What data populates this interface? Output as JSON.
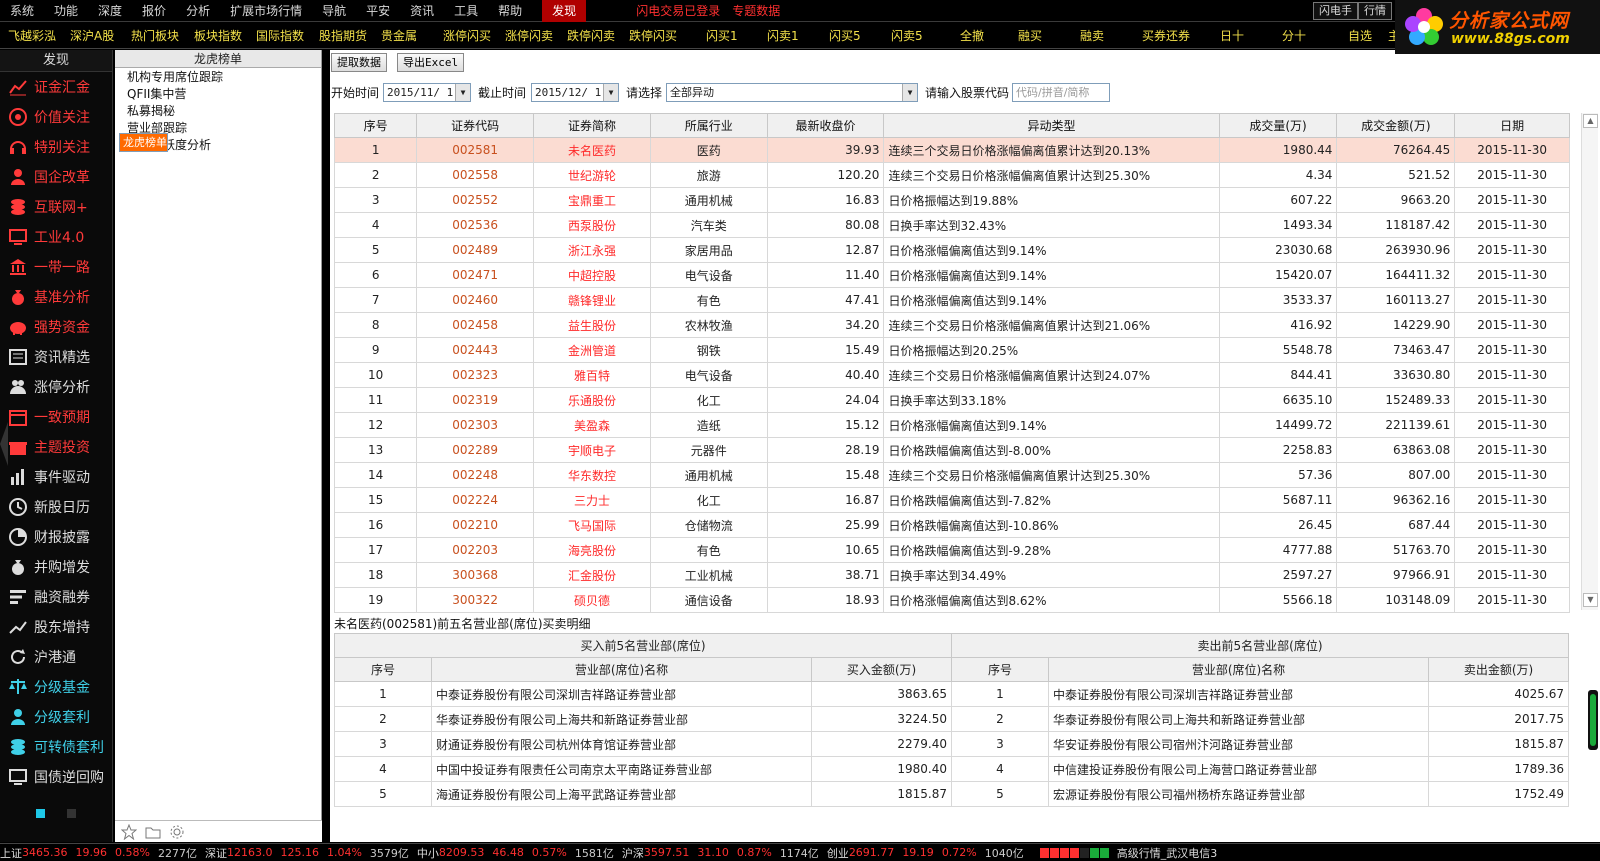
{
  "menubar": {
    "items": [
      "系统",
      "功能",
      "深度",
      "报价",
      "分析",
      "扩展市场行情",
      "导航",
      "平安",
      "资讯",
      "工具",
      "帮助"
    ],
    "active": "发现",
    "alert": "闪电交易已登录",
    "alert2": "专题数据",
    "btn1": "闪电手",
    "btn2": "行情"
  },
  "logo": {
    "title": "分析家公式网",
    "url": "www.88gs.com"
  },
  "tabbar": [
    "飞越彩泓",
    "深沪A股",
    "热门板块",
    "板块指数",
    "国际指数",
    "股指期货",
    "贵金属",
    "涨停闪买",
    "涨停闪卖",
    "跌停闪卖",
    "跌停闪买",
    "闪买1",
    "闪卖1",
    "闪买5",
    "闪卖5",
    "全撤",
    "融买",
    "融卖",
    "买券还券",
    "日十",
    "分十",
    "自选",
    "主力"
  ],
  "leftnav": {
    "header": "发现",
    "items": [
      {
        "label": "证金汇金",
        "color": "red",
        "icon": "chart-line-icon"
      },
      {
        "label": "价值关注",
        "color": "red",
        "icon": "target-icon"
      },
      {
        "label": "特别关注",
        "color": "red",
        "icon": "headset-icon"
      },
      {
        "label": "国企改革",
        "color": "red",
        "icon": "person-icon"
      },
      {
        "label": "互联网+",
        "color": "red",
        "icon": "coins-icon"
      },
      {
        "label": "工业4.0",
        "color": "red",
        "icon": "monitor-icon"
      },
      {
        "label": "一带一路",
        "color": "red",
        "icon": "bank-icon"
      },
      {
        "label": "基准分析",
        "color": "red",
        "icon": "money-bag-icon"
      },
      {
        "label": "强势资金",
        "color": "red",
        "icon": "piggy-bank-icon"
      },
      {
        "label": "资讯精选",
        "color": "white",
        "icon": "news-icon"
      },
      {
        "label": "涨停分析",
        "color": "white",
        "icon": "person-group-icon"
      },
      {
        "label": "一致预期",
        "color": "red",
        "icon": "calendar-icon"
      },
      {
        "label": "主题投资",
        "color": "red",
        "icon": "gift-icon"
      },
      {
        "label": "事件驱动",
        "color": "white",
        "icon": "bar-chart-icon"
      },
      {
        "label": "新股日历",
        "color": "white",
        "icon": "clock-icon"
      },
      {
        "label": "财报披露",
        "color": "white",
        "icon": "pie-chart-icon"
      },
      {
        "label": "并购增发",
        "color": "white",
        "icon": "money-bag-icon"
      },
      {
        "label": "融资融券",
        "color": "white",
        "icon": "bar-list-icon"
      },
      {
        "label": "股东增持",
        "color": "white",
        "icon": "trend-up-icon"
      },
      {
        "label": "沪港通",
        "color": "white",
        "icon": "refresh-icon"
      },
      {
        "label": "分级基金",
        "color": "cyan",
        "icon": "balance-icon"
      },
      {
        "label": "分级套利",
        "color": "cyan",
        "icon": "person-icon"
      },
      {
        "label": "可转债套利",
        "color": "cyan",
        "icon": "coins-icon"
      },
      {
        "label": "国债逆回购",
        "color": "white",
        "icon": "monitor-icon"
      }
    ]
  },
  "tree": {
    "header": "龙虎榜单",
    "items": [
      "龙虎榜单",
      "机构专用席位跟踪",
      "QFII集中营",
      "私募揭秘",
      "营业部跟踪",
      "席位活跃度分析"
    ],
    "selected": 0
  },
  "toolbar": {
    "fetch": "提取数据",
    "export": "导出Excel"
  },
  "filters": {
    "start_label": "开始时间",
    "start_value": "2015/11/ 1",
    "end_label": "截止时间",
    "end_value": "2015/12/ 1",
    "choose_label": "请选择",
    "choose_value": "全部异动",
    "code_label": "请输入股票代码",
    "code_placeholder": "代码/拼音/简称"
  },
  "main_table": {
    "headers": [
      "序号",
      "证券代码",
      "证券简称",
      "所属行业",
      "最新收盘价",
      "异动类型",
      "成交量(万)",
      "成交金额(万)",
      "日期"
    ],
    "rows": [
      [
        "1",
        "002581",
        "未名医药",
        "医药",
        "39.93",
        "连续三个交易日价格涨幅偏离值累计达到20.13%",
        "1980.44",
        "76264.45",
        "2015-11-30"
      ],
      [
        "2",
        "002558",
        "世纪游轮",
        "旅游",
        "120.20",
        "连续三个交易日价格涨幅偏离值累计达到25.30%",
        "4.34",
        "521.52",
        "2015-11-30"
      ],
      [
        "3",
        "002552",
        "宝鼎重工",
        "通用机械",
        "16.83",
        "日价格振幅达到19.88%",
        "607.22",
        "9663.20",
        "2015-11-30"
      ],
      [
        "4",
        "002536",
        "西泵股份",
        "汽车类",
        "80.08",
        "日换手率达到32.43%",
        "1493.34",
        "118187.42",
        "2015-11-30"
      ],
      [
        "5",
        "002489",
        "浙江永强",
        "家居用品",
        "12.87",
        "日价格涨幅偏离值达到9.14%",
        "23030.68",
        "263930.96",
        "2015-11-30"
      ],
      [
        "6",
        "002471",
        "中超控股",
        "电气设备",
        "11.40",
        "日价格涨幅偏离值达到9.14%",
        "15420.07",
        "164411.32",
        "2015-11-30"
      ],
      [
        "7",
        "002460",
        "赣锋锂业",
        "有色",
        "47.41",
        "日价格涨幅偏离值达到9.14%",
        "3533.37",
        "160113.27",
        "2015-11-30"
      ],
      [
        "8",
        "002458",
        "益生股份",
        "农林牧渔",
        "34.20",
        "连续三个交易日价格涨幅偏离值累计达到21.06%",
        "416.92",
        "14229.90",
        "2015-11-30"
      ],
      [
        "9",
        "002443",
        "金洲管道",
        "钢铁",
        "15.49",
        "日价格振幅达到20.25%",
        "5548.78",
        "73463.47",
        "2015-11-30"
      ],
      [
        "10",
        "002323",
        "雅百特",
        "电气设备",
        "40.40",
        "连续三个交易日价格涨幅偏离值累计达到24.07%",
        "844.41",
        "33630.80",
        "2015-11-30"
      ],
      [
        "11",
        "002319",
        "乐通股份",
        "化工",
        "24.04",
        "日换手率达到33.18%",
        "6635.10",
        "152489.33",
        "2015-11-30"
      ],
      [
        "12",
        "002303",
        "美盈森",
        "造纸",
        "15.12",
        "日价格涨幅偏离值达到9.14%",
        "14499.72",
        "221139.61",
        "2015-11-30"
      ],
      [
        "13",
        "002289",
        "宇顺电子",
        "元器件",
        "28.19",
        "日价格跌幅偏离值达到-8.00%",
        "2258.83",
        "63863.08",
        "2015-11-30"
      ],
      [
        "14",
        "002248",
        "华东数控",
        "通用机械",
        "15.48",
        "连续三个交易日价格涨幅偏离值累计达到25.30%",
        "57.36",
        "807.00",
        "2015-11-30"
      ],
      [
        "15",
        "002224",
        "三力士",
        "化工",
        "16.87",
        "日价格跌幅偏离值达到-7.82%",
        "5687.11",
        "96362.16",
        "2015-11-30"
      ],
      [
        "16",
        "002210",
        "飞马国际",
        "仓储物流",
        "25.99",
        "日价格跌幅偏离值达到-10.86%",
        "26.45",
        "687.44",
        "2015-11-30"
      ],
      [
        "17",
        "002203",
        "海亮股份",
        "有色",
        "10.65",
        "日价格跌幅偏离值达到-9.28%",
        "4777.88",
        "51763.70",
        "2015-11-30"
      ],
      [
        "18",
        "300368",
        "汇金股份",
        "工业机械",
        "38.71",
        "日换手率达到34.49%",
        "2597.27",
        "97966.91",
        "2015-11-30"
      ],
      [
        "19",
        "300322",
        "硕贝德",
        "通信设备",
        "18.93",
        "日价格涨幅偏离值达到8.62%",
        "5566.18",
        "103148.09",
        "2015-11-30"
      ]
    ],
    "selected": 0
  },
  "detail": {
    "title": "未名医药(002581)前五名营业部(席位)买卖明细",
    "buy": {
      "group": "买入前5名营业部(席位)",
      "headers": [
        "序号",
        "营业部(席位)名称",
        "买入金额(万)"
      ],
      "rows": [
        [
          "1",
          "中泰证券股份有限公司深圳吉祥路证券营业部",
          "3863.65"
        ],
        [
          "2",
          "华泰证券股份有限公司上海共和新路证券营业部",
          "3224.50"
        ],
        [
          "3",
          "财通证券股份有限公司杭州体育馆证券营业部",
          "2279.40"
        ],
        [
          "4",
          "中国中投证券有限责任公司南京太平南路证券营业部",
          "1980.40"
        ],
        [
          "5",
          "海通证券股份有限公司上海平武路证券营业部",
          "1815.87"
        ]
      ]
    },
    "sell": {
      "group": "卖出前5名营业部(席位)",
      "headers": [
        "序号",
        "营业部(席位)名称",
        "卖出金额(万)"
      ],
      "rows": [
        [
          "1",
          "中泰证券股份有限公司深圳吉祥路证券营业部",
          "4025.67"
        ],
        [
          "2",
          "华泰证券股份有限公司上海共和新路证券营业部",
          "2017.75"
        ],
        [
          "3",
          "华安证券股份有限公司宿州汴河路证券营业部",
          "1815.87"
        ],
        [
          "4",
          "中信建投证券股份有限公司上海营口路证券营业部",
          "1789.36"
        ],
        [
          "5",
          "宏源证券股份有限公司福州杨桥东路证券营业部",
          "1752.49"
        ]
      ]
    }
  },
  "status": [
    {
      "name": "上证",
      "value": "3465.36",
      "chg": "19.96",
      "pct": "0.58%",
      "amt": "2277亿"
    },
    {
      "name": "深证",
      "value": "12163.0",
      "chg": "125.16",
      "pct": "1.04%",
      "amt": "3579亿"
    },
    {
      "name": "中小",
      "value": "8209.53",
      "chg": "46.48",
      "pct": "0.57%",
      "amt": "1581亿"
    },
    {
      "name": "沪深",
      "value": "3597.51",
      "chg": "31.10",
      "pct": "0.87%",
      "amt": "1174亿"
    },
    {
      "name": "创业",
      "value": "2691.77",
      "chg": "19.19",
      "pct": "0.72%",
      "amt": "1040亿"
    }
  ],
  "status_right": "高级行情_武汉电信3",
  "colors": {
    "accent": "#ff6a00",
    "up": "#ff3030",
    "code": "#c8501e",
    "tab": "#f2e04a",
    "selected_row": "#fbdcd2"
  }
}
